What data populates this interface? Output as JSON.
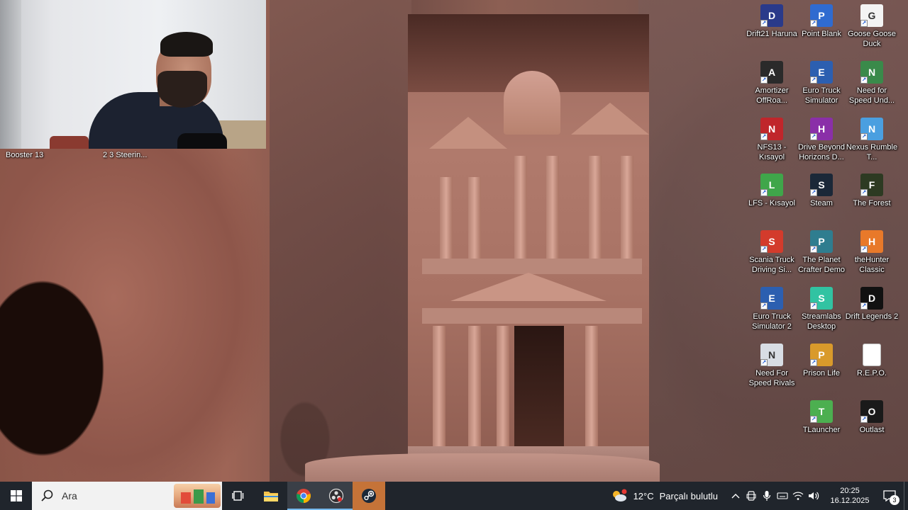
{
  "webcam": {
    "labels": [
      "Booster 13",
      "2 3 Steerin..."
    ]
  },
  "desktop_icons": [
    {
      "label": "Drift21 Haruna",
      "icon": "drift21-icon",
      "color": "#2a3a8a",
      "glyph": "D"
    },
    {
      "label": "Point Blank",
      "icon": "point-blank-icon",
      "color": "#2f6bd0",
      "glyph": "P"
    },
    {
      "label": "Goose Goose Duck",
      "icon": "goose-goose-duck-icon",
      "color": "#f4f4f4",
      "glyph": "G"
    },
    {
      "label": "Amortizer OffRoa...",
      "icon": "amortizer-offroad-icon",
      "color": "#2a2a2a",
      "glyph": "A"
    },
    {
      "label": "Euro Truck Simulator",
      "icon": "euro-truck-simulator-icon",
      "color": "#2c5fb0",
      "glyph": "E"
    },
    {
      "label": "Need for Speed Und...",
      "icon": "need-for-speed-underground-icon",
      "color": "#3a8a4a",
      "glyph": "N"
    },
    {
      "label": "NFS13 - Kısayol",
      "icon": "nfs13-icon",
      "color": "#c0262b",
      "glyph": "N"
    },
    {
      "label": "Drive Beyond Horizons D...",
      "icon": "drive-beyond-horizons-icon",
      "color": "#8a2fa8",
      "glyph": "H"
    },
    {
      "label": "Nexus Rumble T...",
      "icon": "nexus-rumble-icon",
      "color": "#4a9fe0",
      "glyph": "N"
    },
    {
      "label": "LFS - Kısayol",
      "icon": "lfs-icon",
      "color": "#3fa64a",
      "glyph": "L"
    },
    {
      "label": "Steam",
      "icon": "steam-icon",
      "color": "#1b2838",
      "glyph": "S"
    },
    {
      "label": "The Forest",
      "icon": "the-forest-icon",
      "color": "#2d3a22",
      "glyph": "F"
    },
    {
      "label": "Scania Truck Driving Si...",
      "icon": "scania-truck-icon",
      "color": "#d33b2c",
      "glyph": "S"
    },
    {
      "label": "The Planet Crafter Demo",
      "icon": "planet-crafter-icon",
      "color": "#2f7d8f",
      "glyph": "P"
    },
    {
      "label": "theHunter Classic",
      "icon": "thehunter-classic-icon",
      "color": "#e8792a",
      "glyph": "H"
    },
    {
      "label": "Euro Truck Simulator 2",
      "icon": "euro-truck-simulator-2-icon",
      "color": "#2c5fb0",
      "glyph": "E"
    },
    {
      "label": "Streamlabs Desktop",
      "icon": "streamlabs-icon",
      "color": "#31c3a2",
      "glyph": "S"
    },
    {
      "label": "Drift Legends 2",
      "icon": "drift-legends-2-icon",
      "color": "#111111",
      "glyph": "D"
    },
    {
      "label": "Need For Speed Rivals",
      "icon": "need-for-speed-rivals-icon",
      "color": "#d8dde4",
      "glyph": "N"
    },
    {
      "label": "Prison Life",
      "icon": "prison-life-icon",
      "color": "#d99a2b",
      "glyph": "P"
    },
    {
      "label": "R.E.P.O.",
      "icon": "repo-file-icon",
      "color": "#ffffff",
      "glyph": ""
    },
    {
      "label": "TLauncher",
      "icon": "tlauncher-icon",
      "color": "#4caf50",
      "glyph": "T"
    },
    {
      "label": "Outlast",
      "icon": "outlast-icon",
      "color": "#1a1a1a",
      "glyph": "O"
    }
  ],
  "taskbar": {
    "search_placeholder": "Ara",
    "apps": [
      {
        "name": "task-view",
        "icon": "task-view-icon"
      },
      {
        "name": "file-explorer",
        "icon": "folder-icon"
      },
      {
        "name": "chrome",
        "icon": "chrome-icon"
      },
      {
        "name": "obs",
        "icon": "obs-icon"
      },
      {
        "name": "steam",
        "icon": "steam-icon"
      }
    ],
    "weather": {
      "temp": "12°C",
      "condition": "Parçalı bulutlu"
    },
    "clock": {
      "time": "20:25",
      "date": "16.12.2025"
    },
    "notification_count": "3"
  },
  "colors": {
    "taskbar_bg": "#20252c",
    "accent": "#76b9ed",
    "steam_active": "#c57338"
  }
}
